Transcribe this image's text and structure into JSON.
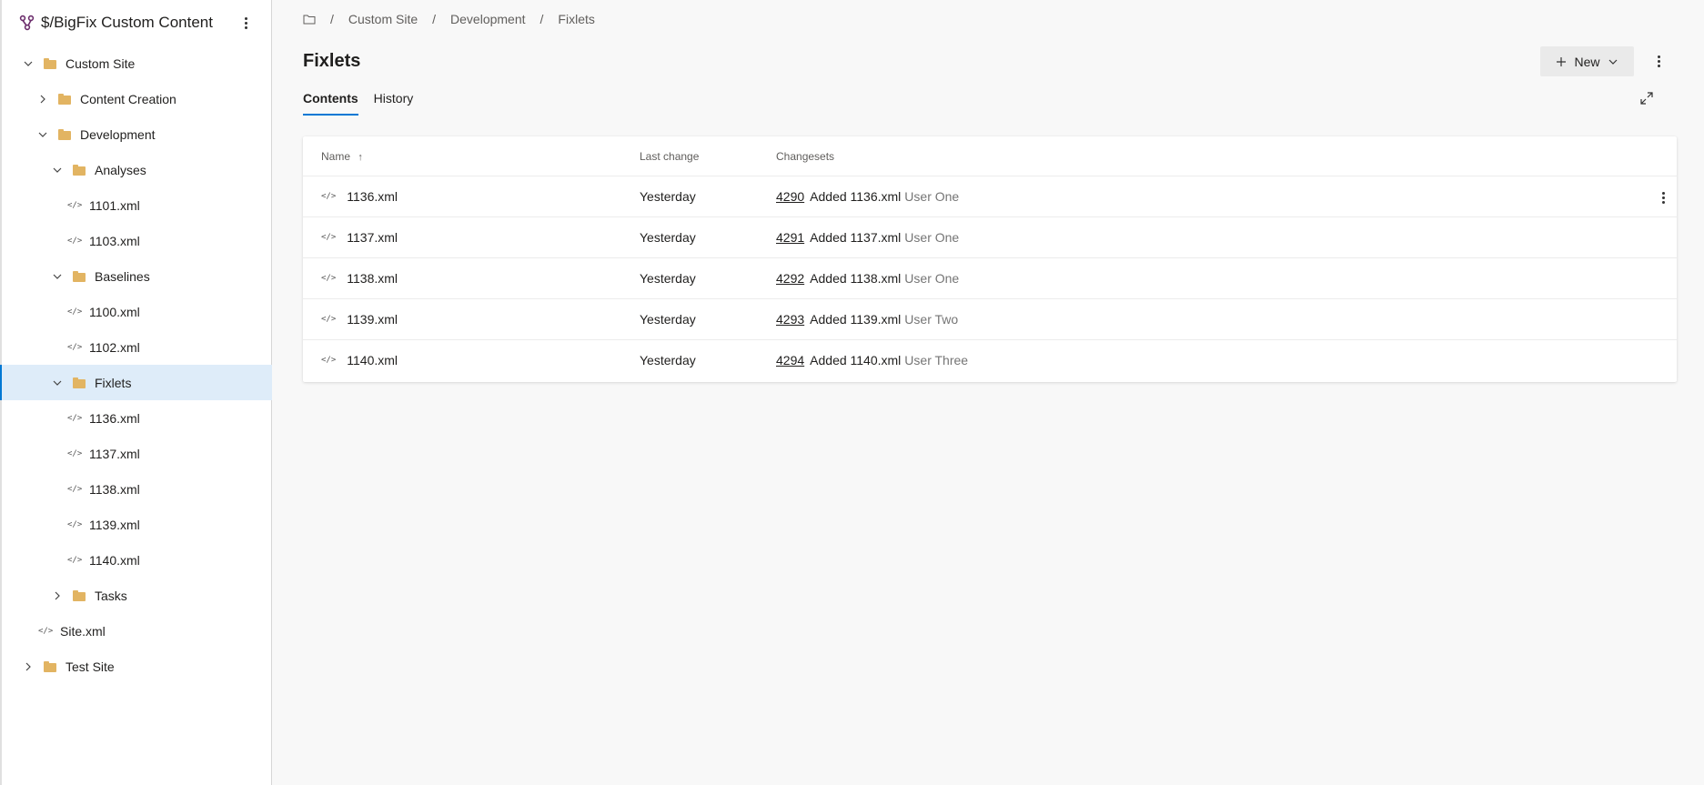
{
  "repo": {
    "title": "$/BigFix Custom Content"
  },
  "tree": [
    {
      "label": "Custom Site",
      "type": "folder",
      "expanded": true
    },
    {
      "label": "Content Creation",
      "type": "folder",
      "expanded": false
    },
    {
      "label": "Development",
      "type": "folder",
      "expanded": true
    },
    {
      "label": "Analyses",
      "type": "folder",
      "expanded": true
    },
    {
      "label": "1101.xml",
      "type": "file"
    },
    {
      "label": "1103.xml",
      "type": "file"
    },
    {
      "label": "Baselines",
      "type": "folder",
      "expanded": true
    },
    {
      "label": "1100.xml",
      "type": "file"
    },
    {
      "label": "1102.xml",
      "type": "file"
    },
    {
      "label": "Fixlets",
      "type": "folder",
      "expanded": true,
      "selected": true
    },
    {
      "label": "1136.xml",
      "type": "file"
    },
    {
      "label": "1137.xml",
      "type": "file"
    },
    {
      "label": "1138.xml",
      "type": "file"
    },
    {
      "label": "1139.xml",
      "type": "file"
    },
    {
      "label": "1140.xml",
      "type": "file"
    },
    {
      "label": "Tasks",
      "type": "folder",
      "expanded": false
    },
    {
      "label": "Site.xml",
      "type": "file"
    },
    {
      "label": "Test Site",
      "type": "folder",
      "expanded": false
    }
  ],
  "breadcrumb": [
    "Custom Site",
    "Development",
    "Fixlets"
  ],
  "page": {
    "title": "Fixlets",
    "new_label": "New",
    "tabs": [
      "Contents",
      "History"
    ]
  },
  "table": {
    "headers": {
      "name": "Name",
      "last_change": "Last change",
      "changesets": "Changesets"
    },
    "rows": [
      {
        "name": "1136.xml",
        "last_change": "Yesterday",
        "cs_id": "4290",
        "cs_msg": "Added 1136.xml",
        "cs_user": "User One"
      },
      {
        "name": "1137.xml",
        "last_change": "Yesterday",
        "cs_id": "4291",
        "cs_msg": "Added 1137.xml",
        "cs_user": "User One"
      },
      {
        "name": "1138.xml",
        "last_change": "Yesterday",
        "cs_id": "4292",
        "cs_msg": "Added 1138.xml",
        "cs_user": "User One"
      },
      {
        "name": "1139.xml",
        "last_change": "Yesterday",
        "cs_id": "4293",
        "cs_msg": "Added 1139.xml",
        "cs_user": "User Two"
      },
      {
        "name": "1140.xml",
        "last_change": "Yesterday",
        "cs_id": "4294",
        "cs_msg": "Added 1140.xml",
        "cs_user": "User Three"
      }
    ]
  },
  "icons": {
    "repo": "repo-branch-icon",
    "folder": "folder-icon",
    "file": "code-file-icon",
    "more": "more-vertical-icon",
    "expand": "expand-icon",
    "sort": "sort-ascending-icon"
  },
  "colors": {
    "accent": "#0078d4",
    "repo_icon": "#6b2c6b",
    "folder": "#e2b462",
    "selected_bg": "#deecf9"
  }
}
